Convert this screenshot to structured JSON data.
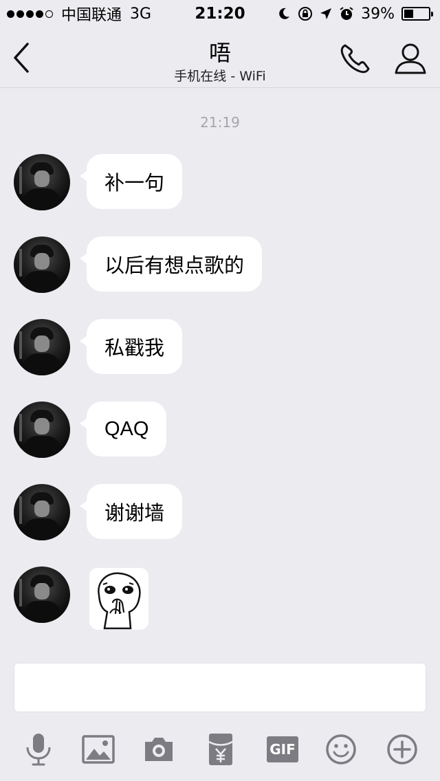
{
  "status_bar": {
    "carrier": "中国联通",
    "network": "3G",
    "time": "21:20",
    "battery": "39%",
    "battery_level": 0.39,
    "signal_bars": 4,
    "signal_max": 5
  },
  "nav": {
    "title": "唔",
    "subtitle": "手机在线 - WiFi"
  },
  "chat": {
    "timestamp": "21:19",
    "messages": [
      {
        "type": "text",
        "text": "补一句"
      },
      {
        "type": "text",
        "text": "以后有想点歌的"
      },
      {
        "type": "text",
        "text": "私戳我"
      },
      {
        "type": "text",
        "text": "QAQ"
      },
      {
        "type": "text",
        "text": "谢谢墙"
      },
      {
        "type": "sticker",
        "sticker": "sticker-face"
      }
    ]
  },
  "input": {
    "value": "",
    "placeholder": ""
  },
  "toolbar": {
    "gif_label": "GIF",
    "icons": [
      "microphone-icon",
      "image-icon",
      "camera-icon",
      "red-packet-icon",
      "gif-icon",
      "emoji-icon",
      "plus-icon"
    ]
  },
  "colors": {
    "background": "#ebebf0",
    "bubble": "#ffffff",
    "icon": "#7c7c82",
    "timestamp": "#a5a5ab"
  }
}
